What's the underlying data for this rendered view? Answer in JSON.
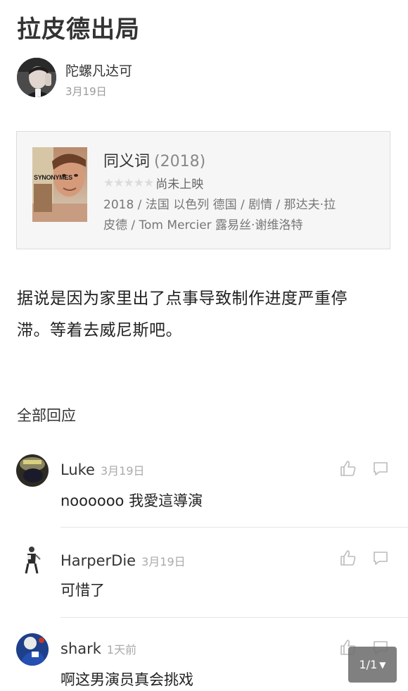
{
  "post": {
    "title": "拉皮德出局",
    "author": {
      "name": "陀螺凡达可",
      "date": "3月19日"
    }
  },
  "movie": {
    "title": "同义词",
    "year": "(2018)",
    "stars": "★★★★★",
    "rating_text": "尚未上映",
    "meta_line1": "2018 / 法国 以色列 德国 / 剧情 / 那达夫·拉",
    "meta_line2": "皮德 / Tom Mercier 露易丝·谢维洛特",
    "poster_text": "SYNONYMES"
  },
  "body": {
    "line1": "据说是因为家里出了点事导致制作进度严重停",
    "line2": "滞。等着去威尼斯吧。"
  },
  "comments_section": {
    "title": "全部回应",
    "comments": [
      {
        "name": "Luke",
        "date": "3月19日",
        "text": "noooooo 我愛這導演"
      },
      {
        "name": "HarperDie",
        "date": "3月19日",
        "text": "可惜了"
      },
      {
        "name": "shark",
        "date": "1天前",
        "text": "啊这男演员真会挑戏"
      }
    ]
  },
  "pager": {
    "label": "1/1",
    "caret": "▼"
  }
}
